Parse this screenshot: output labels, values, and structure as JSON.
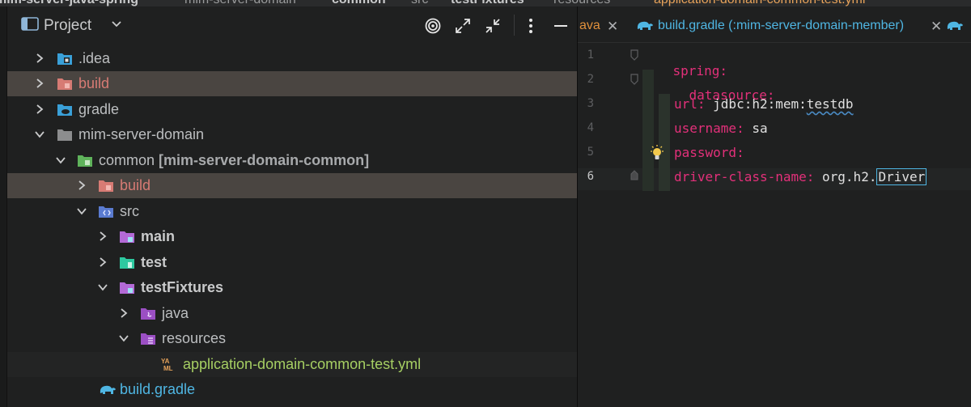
{
  "breadcrumb": {
    "items": [
      {
        "text": "mim-server-java-spring",
        "bold": true
      },
      {
        "text": "mim-server-domain",
        "bold": false
      },
      {
        "text": "common",
        "bold": true
      },
      {
        "text": "src",
        "bold": false
      },
      {
        "text": "testFixtures",
        "bold": true
      },
      {
        "text": "resources",
        "bold": false
      },
      {
        "text": "application-domain-common-test.yml",
        "bold": false
      }
    ]
  },
  "project_panel": {
    "title": "Project"
  },
  "tree": [
    {
      "label": "",
      "name_bold": ".idea",
      "module": "",
      "style": "normal"
    },
    {
      "name_bold": "build",
      "module": "",
      "style": "red"
    },
    {
      "name_bold": "gradle",
      "module": "",
      "style": "normal"
    },
    {
      "name_bold": "mim-server-domain",
      "module": "",
      "style": "normal"
    },
    {
      "name_bold": "common",
      "module": "[mim-server-domain-common]",
      "style": "normal"
    },
    {
      "name_bold": "build",
      "module": "",
      "style": "red"
    },
    {
      "name_bold": "src",
      "module": "",
      "style": "normal"
    },
    {
      "name_bold": "main",
      "module": "",
      "style": "bold"
    },
    {
      "name_bold": "test",
      "module": "",
      "style": "bold"
    },
    {
      "name_bold": "testFixtures",
      "module": "",
      "style": "bold"
    },
    {
      "name_bold": "java",
      "module": "",
      "style": "normal"
    },
    {
      "name_bold": "resources",
      "module": "",
      "style": "normal"
    },
    {
      "name_bold": "application-domain-common-test.yml",
      "module": "",
      "style": "yml"
    },
    {
      "name_bold": "build.gradle",
      "module": "",
      "style": "gradle"
    }
  ],
  "editor": {
    "tab_prev_fragment": "ava",
    "tab_active": "build.gradle (:mim-server-domain-member)",
    "lines": [
      {
        "n": "1",
        "key": "spring:",
        "val": ""
      },
      {
        "n": "2",
        "key": "datasource:",
        "val": ""
      },
      {
        "n": "3",
        "key": "url:",
        "val": " jdbc:h2:mem:",
        "val2": "testdb"
      },
      {
        "n": "4",
        "key": "username:",
        "val": " sa"
      },
      {
        "n": "5",
        "key": "password:",
        "val": ""
      },
      {
        "n": "6",
        "key": "driver-class-name:",
        "val": " org.h2.",
        "val2": "Driver"
      }
    ]
  },
  "colors": {
    "background": "#1f2020",
    "selection": "#4a4541",
    "yaml_key": "#e3307a",
    "yml_file": "#a6cf63",
    "gradle": "#4fb6e3"
  }
}
